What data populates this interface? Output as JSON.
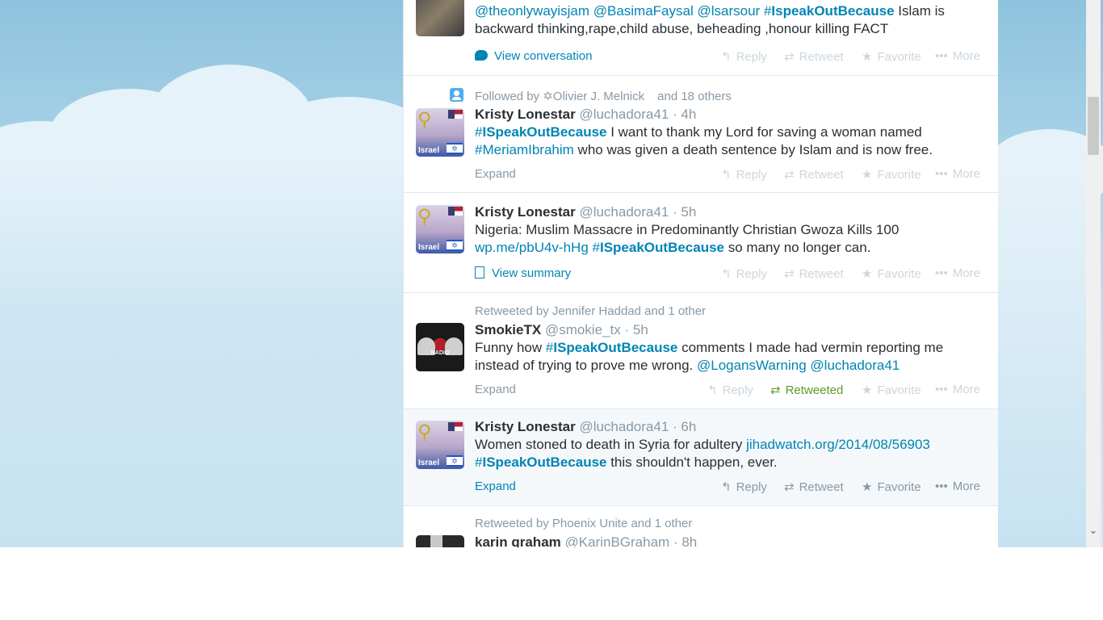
{
  "tweets": [
    {
      "name": "",
      "handle": "",
      "time": "",
      "text_parts": [
        {
          "t": "@theonlywayisjam",
          "k": "link"
        },
        {
          "t": " ",
          "k": "plain"
        },
        {
          "t": "@BasimaFaysal",
          "k": "link"
        },
        {
          "t": " ",
          "k": "plain"
        },
        {
          "t": "@lsarsour",
          "k": "link"
        },
        {
          "t": " ",
          "k": "plain"
        },
        {
          "t": "#",
          "k": "link"
        },
        {
          "t": "IspeakOutBecause",
          "k": "hash"
        },
        {
          "t": " Islam is backward thinking,rape,child abuse, beheading ,honour killing FACT",
          "k": "plain"
        }
      ],
      "footer_left": "View conversation"
    },
    {
      "context": "Followed by",
      "context_name": "✡Olivier J. Melnick",
      "context_more": "and 18 others",
      "name": "Kristy Lonestar",
      "handle": "@luchadora41",
      "dot": "·",
      "time": "4h",
      "text_parts": [
        {
          "t": "#",
          "k": "link"
        },
        {
          "t": "ISpeakOutBecause",
          "k": "hash"
        },
        {
          "t": " I want to thank my Lord for saving a woman named ",
          "k": "plain"
        },
        {
          "t": "#MeriamIbrahim",
          "k": "link"
        },
        {
          "t": " who was given a death sentence by Islam and is now free.",
          "k": "plain"
        }
      ],
      "footer_left": "Expand"
    },
    {
      "name": "Kristy Lonestar",
      "handle": "@luchadora41",
      "dot": "·",
      "time": "5h",
      "text_parts": [
        {
          "t": "Nigeria: Muslim Massacre in Predominantly Christian Gwoza Kills 100 ",
          "k": "plain"
        },
        {
          "t": "wp.me/pbU4v-hHg",
          "k": "link"
        },
        {
          "t": " ",
          "k": "plain"
        },
        {
          "t": "#",
          "k": "link"
        },
        {
          "t": "ISpeakOutBecause",
          "k": "hash"
        },
        {
          "t": " so many no longer can.",
          "k": "plain"
        }
      ],
      "footer_left": "View summary"
    },
    {
      "context": "Retweeted by Jennifer Haddad and 1 other",
      "name": "SmokieTX",
      "handle": "@smokie_tx",
      "dot": "·",
      "time": "5h",
      "text_parts": [
        {
          "t": "Funny how ",
          "k": "plain"
        },
        {
          "t": "#",
          "k": "link"
        },
        {
          "t": "ISpeakOutBecause",
          "k": "hash"
        },
        {
          "t": " comments I made had vermin reporting me instead of trying to prove me wrong. ",
          "k": "plain"
        },
        {
          "t": "@LogansWarning",
          "k": "link"
        },
        {
          "t": " ",
          "k": "plain"
        },
        {
          "t": "@luchadora41",
          "k": "link"
        }
      ],
      "footer_left": "Expand"
    },
    {
      "name": "Kristy Lonestar",
      "handle": "@luchadora41",
      "dot": "·",
      "time": "6h",
      "text_parts": [
        {
          "t": "Women stoned to death in Syria for adultery ",
          "k": "plain"
        },
        {
          "t": "jihadwatch.org/2014/08/56903",
          "k": "link"
        },
        {
          "t": " ",
          "k": "plain"
        },
        {
          "t": "#",
          "k": "link"
        },
        {
          "t": "ISpeakOutBecause",
          "k": "hash"
        },
        {
          "t": " this shouldn't happen, ever.",
          "k": "plain"
        }
      ],
      "footer_left": "Expand"
    },
    {
      "context": "Retweeted by Phoenix Unite and 1 other",
      "name": "karin graham",
      "handle": "@KarinBGraham",
      "dot": "·",
      "time": "8h"
    }
  ],
  "actions": {
    "reply": "Reply",
    "retweet": "Retweet",
    "retweeted": "Retweeted",
    "favorite": "Favorite",
    "more": "More"
  },
  "avatar_captions": {
    "israel": "Israel",
    "radio": "RADIO"
  },
  "icons": {
    "reply": "reply-arrow-icon",
    "retweet": "retweet-icon",
    "favorite": "star-icon",
    "more": "ellipsis-icon",
    "conversation": "speech-bubble-icon",
    "summary": "document-icon",
    "follow": "person-icon"
  },
  "colors": {
    "link": "#0084b4",
    "retweeted": "#609928",
    "muted": "#8899a6",
    "text": "#292f33",
    "background_sky": "#a9d3e8"
  }
}
